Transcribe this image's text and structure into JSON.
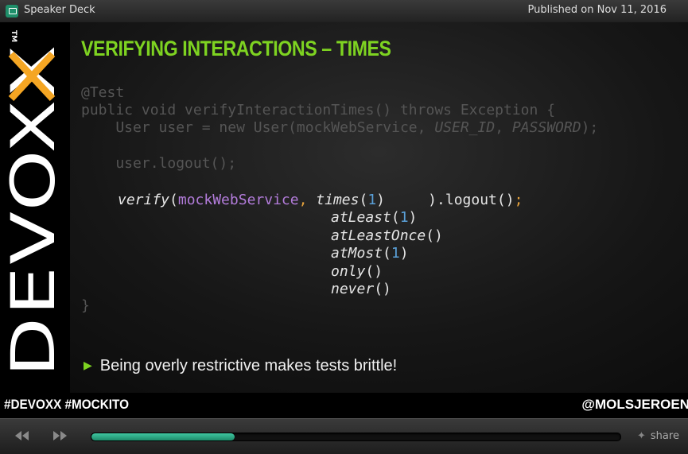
{
  "header": {
    "app_title": "Speaker Deck",
    "published": "Published on Nov 11, 2016"
  },
  "slide": {
    "brand": {
      "wordmark": "DEVOXX",
      "trademark": "TM",
      "accent_color": "#f5a623"
    },
    "title": "VERIFYING INTERACTIONS – TIMES",
    "code": {
      "line1": "@Test",
      "line2": "public void verifyInteractionTimes() throws Exception {",
      "line3a": "    User user = new User(mockWebService, ",
      "line3b": "USER_ID",
      "line3c": ", ",
      "line3d": "PASSWORD",
      "line3e": ");",
      "line4": "    user.logout();",
      "verify": "verify",
      "verify_open": "(",
      "mock": "mockWebService",
      "comma": ",",
      "times": "times",
      "times_arg": "1",
      "tail": "     ).logout()",
      "semicolon": ";",
      "alternatives": [
        {
          "name": "atLeast",
          "open": "(",
          "arg": "1",
          "close": ")"
        },
        {
          "name": "atLeastOnce",
          "open": "()",
          "arg": "",
          "close": ""
        },
        {
          "name": "atMost",
          "open": "(",
          "arg": "1",
          "close": ")"
        },
        {
          "name": "only",
          "open": "()",
          "arg": "",
          "close": ""
        },
        {
          "name": "never",
          "open": "()",
          "arg": "",
          "close": ""
        }
      ],
      "closing_brace": "}"
    },
    "bullet": "Being overly restrictive makes tests brittle!"
  },
  "footer": {
    "hashtags": "#DEVOXX  #MOCKITO",
    "handle": "@MOLSJEROEN"
  },
  "player": {
    "prev_icon": "rewind-icon",
    "next_icon": "fast-forward-icon",
    "progress": 0.27,
    "share_label": "share",
    "share_icon": "twitter-bird-icon"
  }
}
